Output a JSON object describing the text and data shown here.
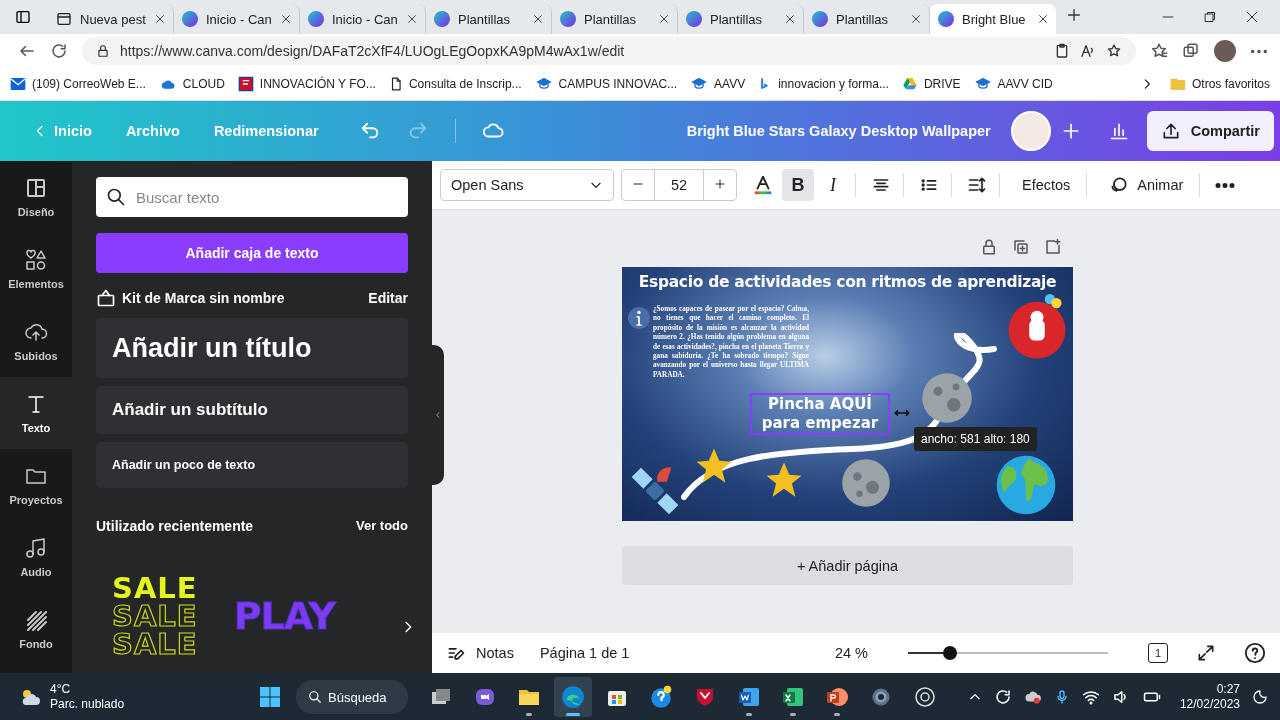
{
  "browser": {
    "tabs": [
      {
        "title": "Nueva pest",
        "kind": "newtab",
        "selected": false
      },
      {
        "title": "Inicio - Can",
        "kind": "canva",
        "selected": false
      },
      {
        "title": "Inicio - Can",
        "kind": "canva",
        "selected": false
      },
      {
        "title": "Plantillas",
        "kind": "canva",
        "selected": false
      },
      {
        "title": "Plantillas",
        "kind": "canva",
        "selected": false
      },
      {
        "title": "Plantillas",
        "kind": "canva",
        "selected": false
      },
      {
        "title": "Plantillas",
        "kind": "canva",
        "selected": false
      },
      {
        "title": "Bright Blue",
        "kind": "canva",
        "selected": true
      }
    ],
    "url": "https://www.canva.com/design/DAFaT2cXfF4/LUOgLEgOopxKA9pM4wAx1w/edit",
    "bookmarks": [
      {
        "label": "(109) CorreoWeb E...",
        "kind": "mail"
      },
      {
        "label": "CLOUD",
        "kind": "cloud"
      },
      {
        "label": "INNOVACIÓN Y FO...",
        "kind": "brand"
      },
      {
        "label": "Consulta de Inscrip...",
        "kind": "page"
      },
      {
        "label": "CAMPUS INNOVAC...",
        "kind": "cap"
      },
      {
        "label": "AAVV",
        "kind": "cap"
      },
      {
        "label": "innovacion y forma...",
        "kind": "bing"
      },
      {
        "label": "DRIVE",
        "kind": "drive"
      },
      {
        "label": "AAVV CID",
        "kind": "cap"
      }
    ],
    "other_favorites": "Otros favoritos"
  },
  "header": {
    "nav": [
      "Inicio",
      "Archivo",
      "Redimensionar"
    ],
    "doc_title": "Bright Blue Stars Galaxy Desktop Wallpaper",
    "share": "Compartir"
  },
  "rail": [
    {
      "label": "Diseño",
      "kind": "design",
      "selected": false
    },
    {
      "label": "Elementos",
      "kind": "elements",
      "selected": false
    },
    {
      "label": "Subidos",
      "kind": "uploads",
      "selected": false
    },
    {
      "label": "Texto",
      "kind": "text",
      "selected": true
    },
    {
      "label": "Proyectos",
      "kind": "projects",
      "selected": false
    },
    {
      "label": "Audio",
      "kind": "audio",
      "selected": false
    },
    {
      "label": "Fondo",
      "kind": "background",
      "selected": false
    }
  ],
  "panel": {
    "search": {
      "placeholder": "Buscar texto"
    },
    "add_textbox": "Añadir caja de texto",
    "brand_kit": {
      "title": "Kit de Marca sin nombre",
      "edit": "Editar"
    },
    "text_styles": [
      {
        "label": "Añadir un título",
        "kind": "title"
      },
      {
        "label": "Añadir un subtítulo",
        "kind": "subtitle"
      },
      {
        "label": "Añadir un poco de texto",
        "kind": "body"
      }
    ],
    "recent": {
      "title": "Utilizado recientemente",
      "see_all": "Ver todo",
      "items": [
        {
          "kind": "sale",
          "lines": [
            "SALE",
            "SALE",
            "SALE"
          ]
        },
        {
          "kind": "play",
          "lines": [
            "PLAY"
          ]
        }
      ]
    }
  },
  "toolbar": {
    "font": "Open Sans",
    "size": "52",
    "format_buttons": [
      {
        "label": "B",
        "kind": "bold",
        "selected": true
      },
      {
        "label": "I",
        "kind": "italic",
        "selected": false
      }
    ],
    "effects": "Efectos",
    "animate": "Animar"
  },
  "design": {
    "title": "Espacio de actividades con ritmos de aprendizaje",
    "paragraph": "¿Somos capaces de pasear por el espacio? Calma, no tienes que hacer el camino completo. El propósito de la misión es alcanzar la actividad número 2. ¿Has tenido algún problema en alguna de esas actividades?, pincha en el planeta Tierra y gana sabiduría. ¿Te ha sobrado tiempo? Sigue avanzando por el universo hasta llegar ULTIMA PARADA.",
    "start_text": [
      "Pincha AQUÍ",
      "para empezar"
    ],
    "size_tooltip": "ancho: 581 alto: 180"
  },
  "add_page": "+ Añadir página",
  "bottom_bar": {
    "notes": "Notas",
    "page": "Página 1 de 1",
    "zoom": "24 %",
    "zoom_slider": {
      "level": 0.21
    },
    "page_count": "1"
  },
  "taskbar": {
    "weather": {
      "temp": "4°C",
      "condition": "Parc. nublado"
    },
    "search": "Búsqueda",
    "apps": [
      {
        "kind": "taskview",
        "running": false,
        "selected": false
      },
      {
        "kind": "teams",
        "running": false,
        "selected": false
      },
      {
        "kind": "explorer",
        "running": true,
        "selected": false
      },
      {
        "kind": "edge",
        "running": true,
        "selected": true
      },
      {
        "kind": "store",
        "running": false,
        "selected": false
      },
      {
        "kind": "help",
        "running": false,
        "selected": false
      },
      {
        "kind": "shield",
        "running": false,
        "selected": false
      },
      {
        "kind": "word",
        "running": true,
        "selected": false
      },
      {
        "kind": "excel",
        "running": true,
        "selected": false
      },
      {
        "kind": "powerpoint",
        "running": true,
        "selected": false
      },
      {
        "kind": "settings",
        "running": false,
        "selected": false
      },
      {
        "kind": "obs",
        "running": false,
        "selected": false
      }
    ],
    "time": "0:27",
    "date": "12/02/2023"
  }
}
